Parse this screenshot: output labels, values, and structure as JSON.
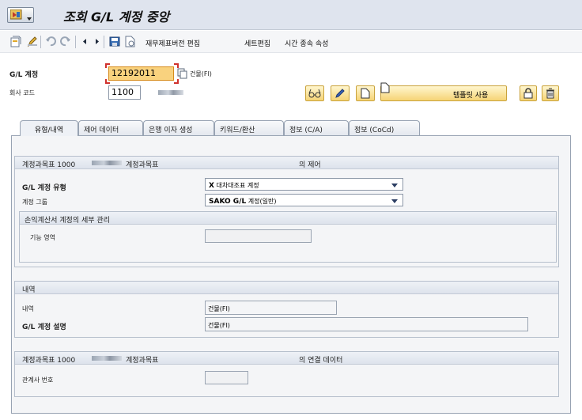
{
  "window": {
    "title": "조회 G/L 계정 중앙"
  },
  "toolbar": {
    "buttons": [
      "재무제표버전 편집",
      "세트편집",
      "시간 종속 속성"
    ]
  },
  "header": {
    "account_label": "G/L 계정",
    "account_value": "12192011",
    "account_desc": "건물(FI)",
    "company_label": "회사 코드",
    "company_value": "1100",
    "template_button": "템플릿 사용"
  },
  "tabs": [
    {
      "label": "유형/내역",
      "active": true
    },
    {
      "label": "제어 데이터",
      "active": false
    },
    {
      "label": "은행 이자 생성",
      "active": false
    },
    {
      "label": "키워드/환산",
      "active": false
    },
    {
      "label": "정보 (C/A)",
      "active": false
    },
    {
      "label": "정보 (CoCd)",
      "active": false
    }
  ],
  "control_group": {
    "header_prefix": "계정과목표 1000",
    "header_mid": "계정과목표",
    "header_suffix": "의 제어",
    "type_label": "G/L 계정 유형",
    "type_code": "X",
    "type_value": "대차대조표 계정",
    "group_label": "계정 그룹",
    "group_code": "SAKO G/L",
    "group_value": "계정(일반)",
    "pl_section_title": "손익계산서 계정의 세부 관리",
    "func_area_label": "기능 영역"
  },
  "desc_group": {
    "title": "내역",
    "short_label": "내역",
    "short_value": "건물(FI)",
    "long_label": "G/L 계정 설명",
    "long_value": "건물(FI)"
  },
  "consol_group": {
    "header_prefix": "계정과목표 1000",
    "header_mid": "계정과목표",
    "header_suffix": "의 연결 데이터",
    "partner_label": "관계사 번호"
  },
  "colors": {
    "accent": "#f9d27e",
    "tab_border": "#98a3b3",
    "header_bg": "#dfe4ee"
  }
}
